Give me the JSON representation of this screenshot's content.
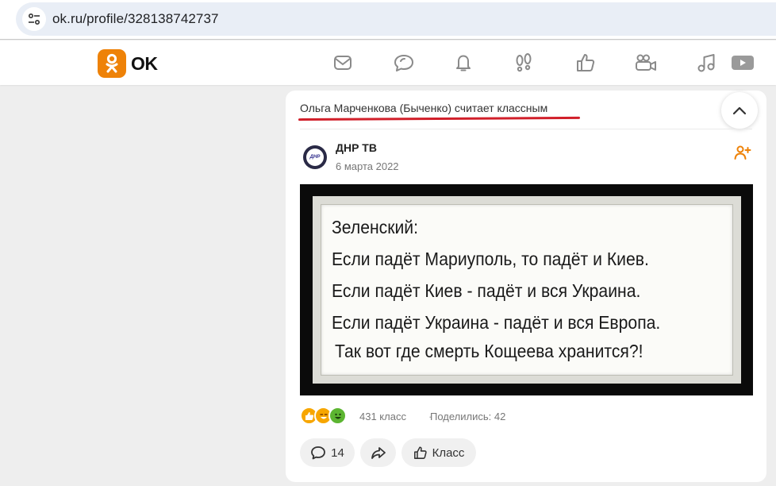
{
  "browser": {
    "url": "ok.ru/profile/328138742737",
    "site_info_icon": "tune-icon"
  },
  "header": {
    "logo_text": "OK",
    "brand_color": "#ee8208",
    "nav_icons": [
      "messages-icon",
      "discussions-icon",
      "notifications-icon",
      "guests-icon",
      "marks-icon",
      "video-calls-icon",
      "music-icon",
      "video-icon"
    ]
  },
  "post": {
    "liker_text": "Ольга Марченкова (Быченко) считает классным",
    "annotation_color": "#d11f2a",
    "group_name": "ДНР ТВ",
    "group_avatar_text": "ДНР",
    "date": "6 марта 2022",
    "image_text": {
      "line1": "Зеленский:",
      "line2": "Если падёт Мариуполь, то падёт  и Киев.",
      "line3": "Если падёт Киев - падёт и вся  Украина.",
      "line4": "Если падёт Украина - падёт и  вся Европа.",
      "line5": "Так вот где смерть Кощеева  хранится?!"
    },
    "likes_text": "431 класс",
    "shares_text": "Поделились: 42",
    "separator": "·",
    "comments_count": "14",
    "class_button_label": "Класс"
  }
}
